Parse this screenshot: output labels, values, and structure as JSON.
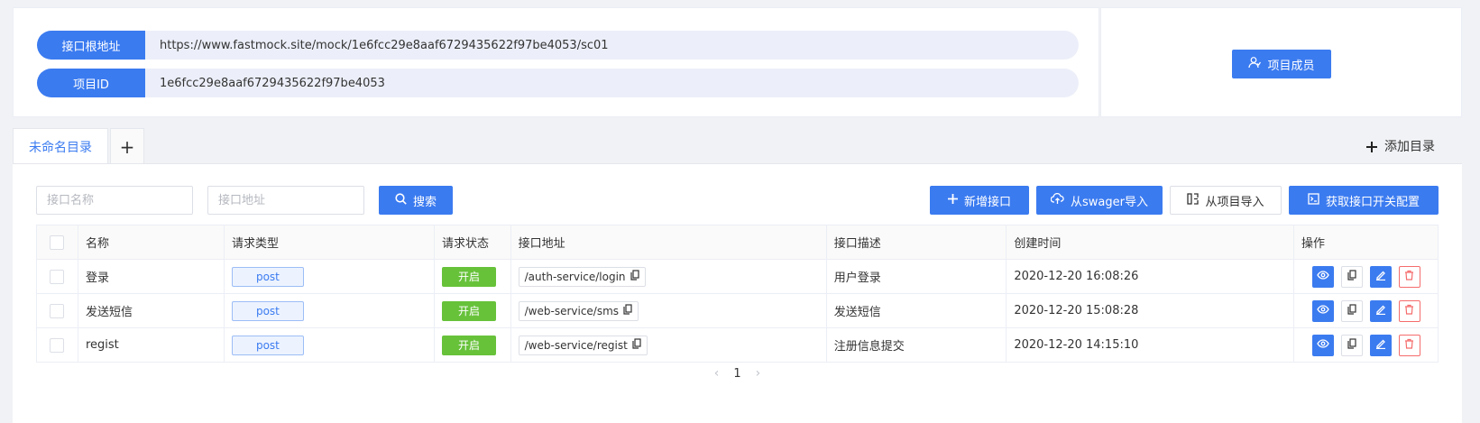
{
  "project": {
    "base_url_label": "接口根地址",
    "base_url": "https://www.fastmock.site/mock/1e6fcc29e8aaf6729435622f97be4053/sc01",
    "id_label": "项目ID",
    "id": "1e6fcc29e8aaf6729435622f97be4053",
    "members_button": "项目成员"
  },
  "tabs": {
    "active": "未命名目录",
    "add_symbol": "+",
    "add_dir_label": "添加目录"
  },
  "toolbar": {
    "name_placeholder": "接口名称",
    "url_placeholder": "接口地址",
    "search_label": "搜索",
    "new_label": "新增接口",
    "swagger_label": "从swager导入",
    "project_import_label": "从项目导入",
    "config_label": "获取接口开关配置"
  },
  "table": {
    "headers": {
      "name": "名称",
      "method": "请求类型",
      "status": "请求状态",
      "url": "接口地址",
      "desc": "接口描述",
      "created": "创建时间",
      "ops": "操作"
    },
    "rows": [
      {
        "name": "登录",
        "method": "post",
        "status": "开启",
        "url": "/auth-service/login",
        "desc": "用户登录",
        "created": "2020-12-20 16:08:26"
      },
      {
        "name": "发送短信",
        "method": "post",
        "status": "开启",
        "url": "/web-service/sms",
        "desc": "发送短信",
        "created": "2020-12-20 15:08:28"
      },
      {
        "name": "regist",
        "method": "post",
        "status": "开启",
        "url": "/web-service/regist",
        "desc": "注册信息提交",
        "created": "2020-12-20 14:15:10"
      }
    ]
  },
  "pagination": {
    "prev": "‹",
    "current": "1",
    "next": "›"
  },
  "colors": {
    "primary": "#3b7bf0",
    "success": "#67c23a",
    "danger": "#f56c6c"
  },
  "icons": [
    "members-icon",
    "plus-icon",
    "search-icon",
    "cloud-upload-icon",
    "import-icon",
    "terminal-icon",
    "copy-icon",
    "eye-icon",
    "edit-icon",
    "delete-icon"
  ]
}
